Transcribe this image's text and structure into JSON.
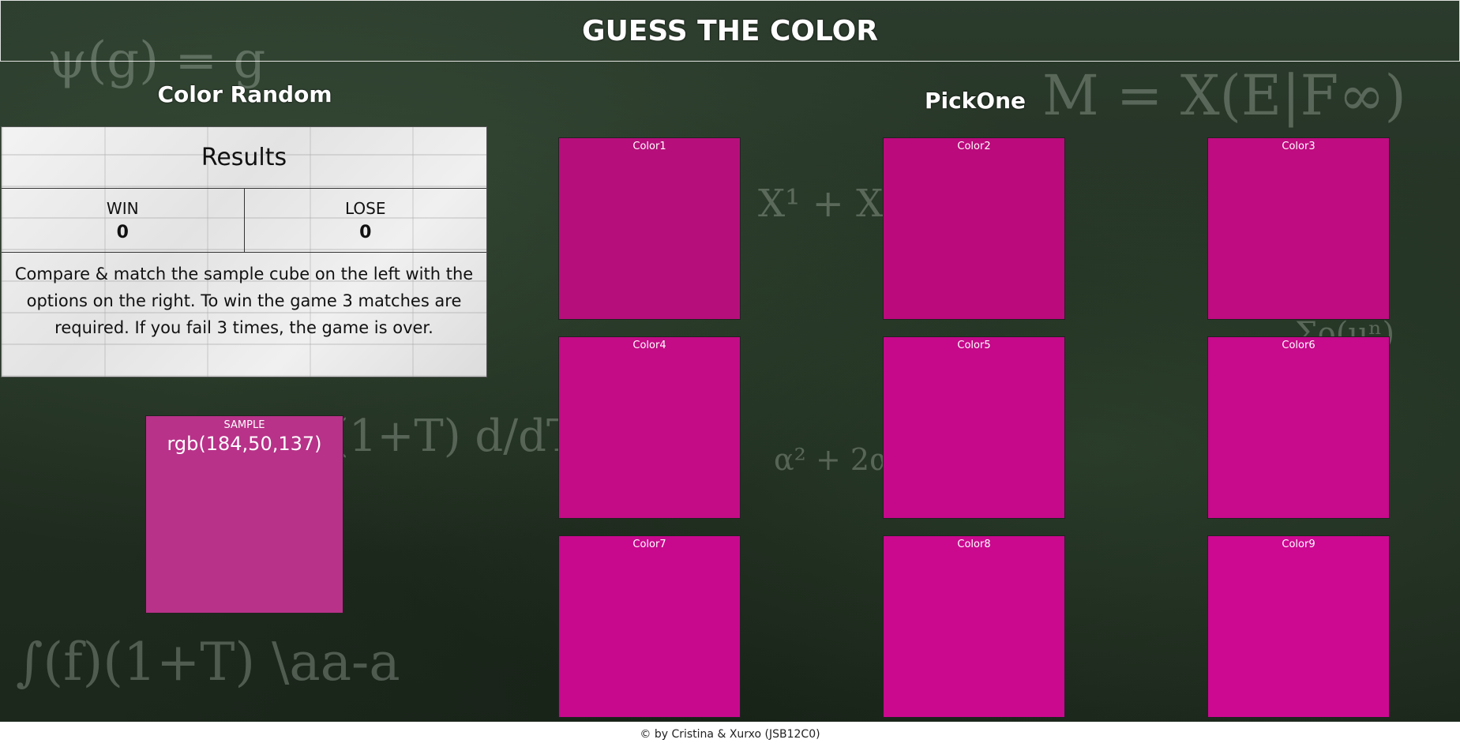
{
  "header": {
    "title": "GUESS THE COLOR"
  },
  "left": {
    "title": "Color Random",
    "results": {
      "heading": "Results",
      "win_label": "WIN",
      "win_value": "0",
      "lose_label": "LOSE",
      "lose_value": "0",
      "instructions": "Compare & match the sample cube on the left with the options on the right. To win the game 3 matches are required. If you fail 3 times, the game is over."
    },
    "sample": {
      "label": "SAMPLE",
      "value": "rgb(184,50,137)",
      "color": "#b83289"
    }
  },
  "right": {
    "title": "PickOne",
    "options": [
      {
        "label": "Color1",
        "color": "#b60f7b"
      },
      {
        "label": "Color2",
        "color": "#bb0a7c"
      },
      {
        "label": "Color3",
        "color": "#bf0c80"
      },
      {
        "label": "Color4",
        "color": "#c30c86"
      },
      {
        "label": "Color5",
        "color": "#c5098a"
      },
      {
        "label": "Color6",
        "color": "#c80a8c"
      },
      {
        "label": "Color7",
        "color": "#c8098e"
      },
      {
        "label": "Color8",
        "color": "#cb098f"
      },
      {
        "label": "Color9",
        "color": "#cd0992"
      }
    ]
  },
  "footer": {
    "text": "© by Cristina & Xurxo (JSB12C0)"
  }
}
